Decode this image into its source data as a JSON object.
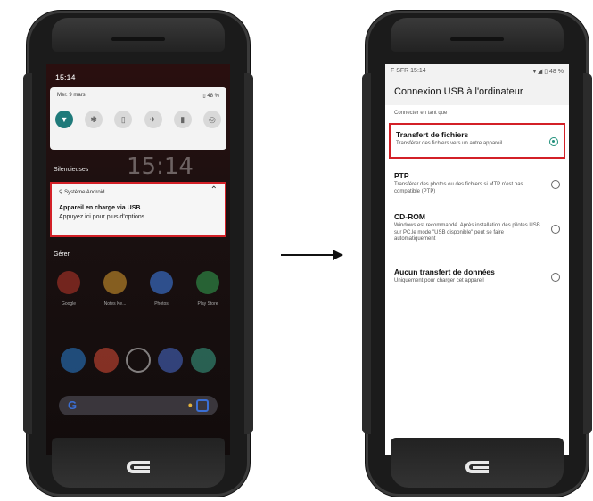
{
  "left_screen": {
    "status_time": "15:14",
    "quick_settings": {
      "date": "Mer. 9 mars",
      "battery": "48 %",
      "toggles": [
        "wifi-icon",
        "bluetooth-icon",
        "battery-saver-icon",
        "airplane-icon",
        "flashlight-icon",
        "hotspot-icon"
      ]
    },
    "section_label": "Silencieuses",
    "clock_bg": "15:14",
    "notification": {
      "app": "Système Android",
      "title": "Appareil en charge via USB",
      "body": "Appuyez ici pour plus d'options."
    },
    "manage_label": "Gérer",
    "apps": [
      {
        "label": "Google",
        "color": "#c0392b"
      },
      {
        "label": "Notes Ke...",
        "color": "#e0a030"
      },
      {
        "label": "Photos",
        "color": "#4285f4"
      },
      {
        "label": "Play Store",
        "color": "#34a853"
      }
    ],
    "dock_colors": [
      "#2a7fd4",
      "#e04e39",
      "#dddddd",
      "#4a6fd4",
      "#3aa58a"
    ],
    "nav": [
      "◀",
      "●",
      "■"
    ]
  },
  "right_screen": {
    "status_left": "F SFR 15:14",
    "status_right": "48 %",
    "title": "Connexion USB à l'ordinateur",
    "section": "Connecter en tant que",
    "options": [
      {
        "title": "Transfert de fichiers",
        "desc": "Transférer des fichiers vers un autre appareil",
        "selected": true
      },
      {
        "title": "PTP",
        "desc": "Transférer des photos ou des fichiers si MTP n'est pas compatible (PTP)",
        "selected": false
      },
      {
        "title": "CD-ROM",
        "desc": "Windows est recommandé. Après installation des pilotes USB sur PC,le mode \"USB disponible\" peut se faire automatiquement",
        "selected": false
      },
      {
        "title": "Aucun transfert de données",
        "desc": "Uniquement pour charger cet appareil",
        "selected": false
      }
    ],
    "nav": [
      "◀",
      "●",
      "■"
    ]
  },
  "colors": {
    "highlight": "#d32027",
    "accent": "#1f8f7a"
  }
}
